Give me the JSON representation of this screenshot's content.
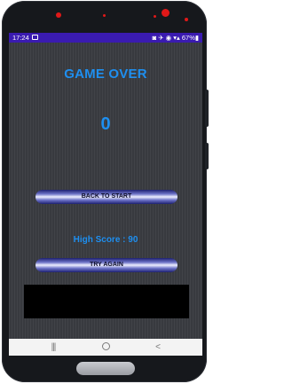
{
  "status_bar": {
    "time": "17:24",
    "right_text": "◙ ✈ ◉ ▾▴ 67%▮"
  },
  "game": {
    "title": "GAME OVER",
    "score": "0",
    "back_to_start_label": "BACK TO START",
    "high_score_text": "High Score : 90",
    "try_again_label": "TRY AGAIN"
  },
  "nav": {
    "recent_icon": "|||",
    "home_icon": "home-circle",
    "back_icon": "<"
  },
  "colors": {
    "status_bar": "#3a1bb0",
    "accent_text": "#1e8ff0",
    "screen_bg": "#3a3c41",
    "phone_body": "#16181c"
  }
}
